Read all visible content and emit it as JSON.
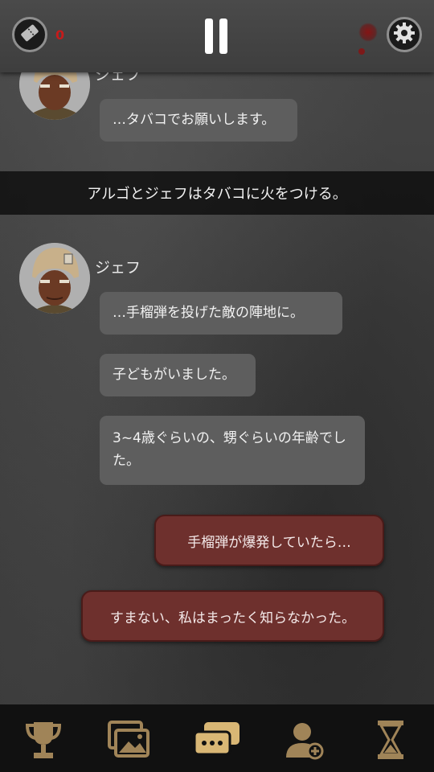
{
  "top_bar": {
    "ticket_count": "0",
    "icons": [
      "ticket-icon",
      "pause-icon",
      "gear-icon"
    ]
  },
  "colors": {
    "player_bubble": "#6e302d",
    "npc_bubble": "#5e5e5e",
    "nav_icon": "#a08458",
    "nav_icon_active": "#d9b775"
  },
  "chat": {
    "previous_message": {
      "speaker": "ジェフ",
      "text": "…タバコでお願いします。"
    },
    "narration": "アルゴとジェフはタバコに火をつける。",
    "speaker": "ジェフ",
    "messages": [
      "…手榴弾を投げた敵の陣地に。",
      "子どもがいました。",
      "3~4歳ぐらいの、甥ぐらいの年齢でした。"
    ],
    "choices": [
      "手榴弾が爆発していたら…",
      "すまない、私はまったく知らなかった。"
    ]
  },
  "bottom_nav": {
    "items": [
      {
        "icon": "trophy-icon",
        "active": false
      },
      {
        "icon": "gallery-icon",
        "active": false
      },
      {
        "icon": "chat-icon",
        "active": true
      },
      {
        "icon": "add-user-icon",
        "active": false
      },
      {
        "icon": "hourglass-icon",
        "active": false
      }
    ]
  }
}
